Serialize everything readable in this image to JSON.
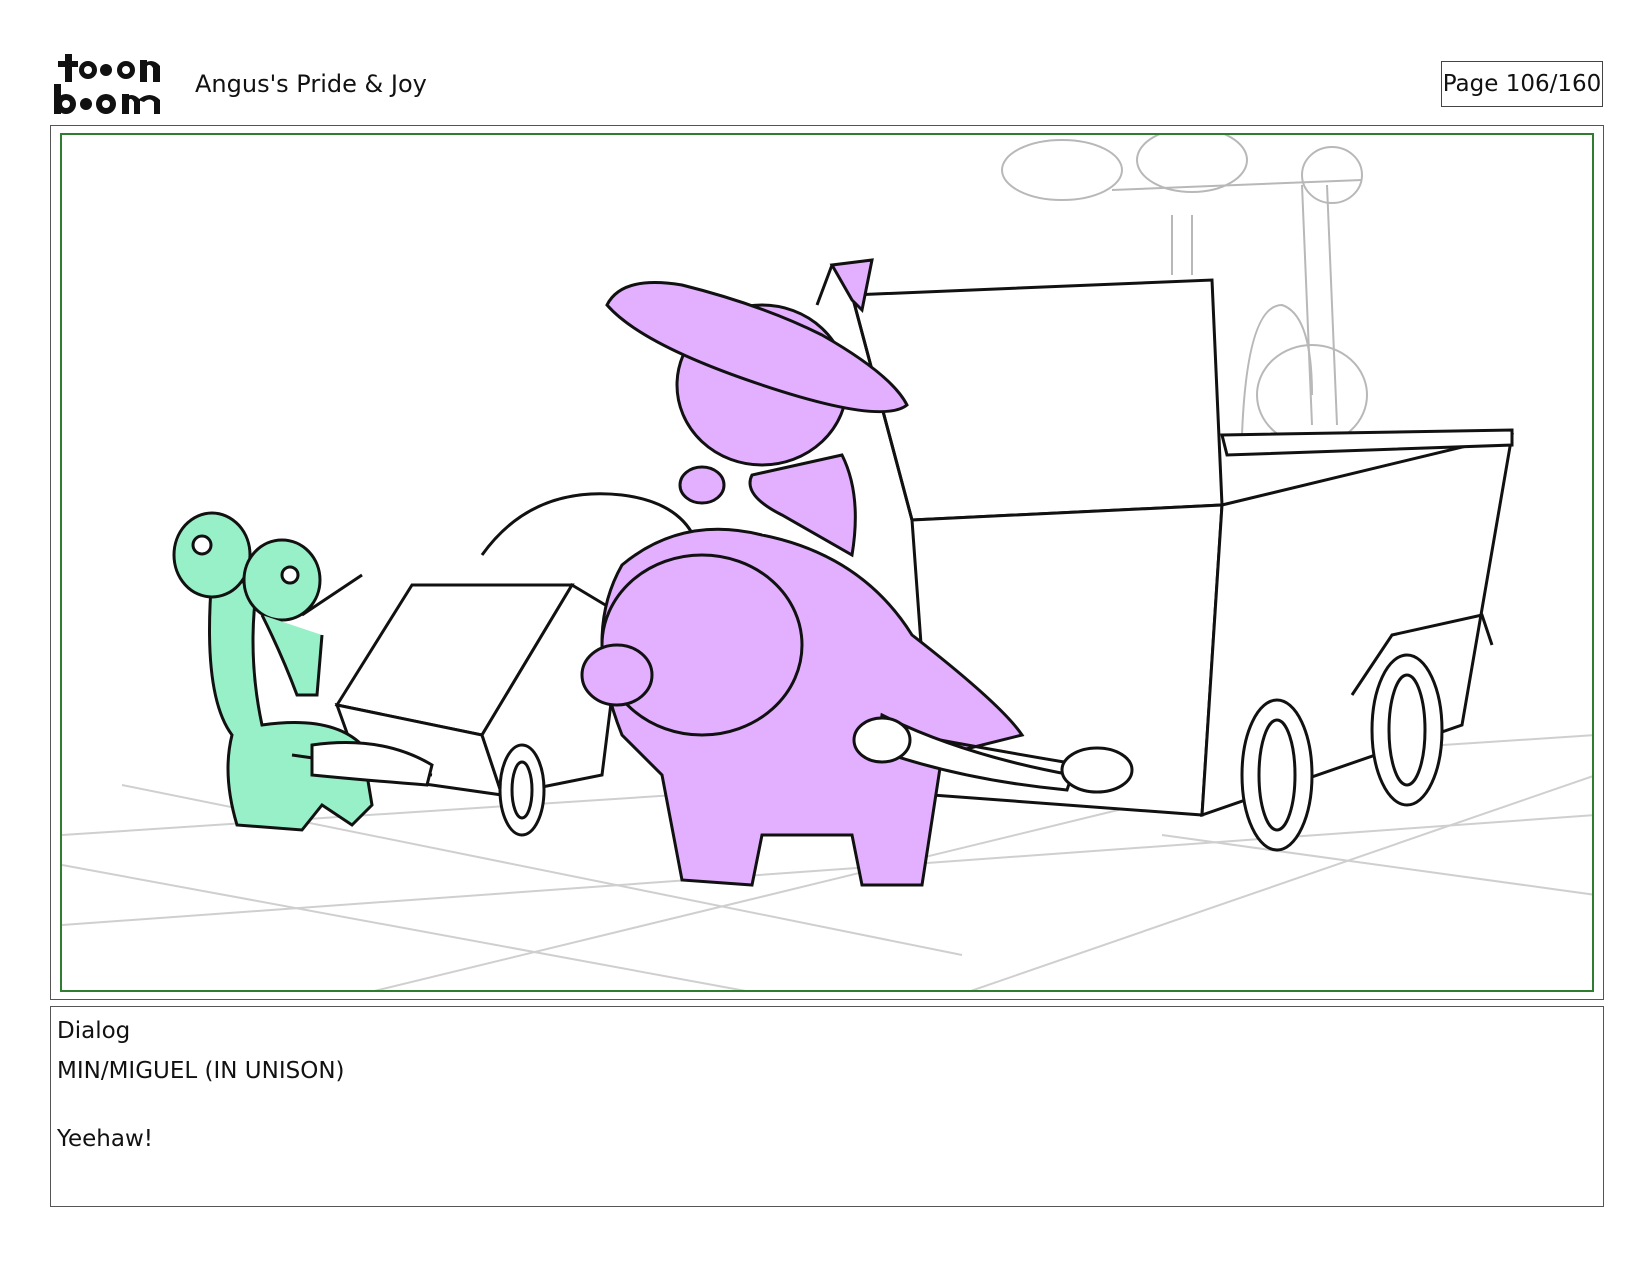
{
  "header": {
    "logo_text": "toon boom",
    "project_title": "Angus's Pride & Joy",
    "page_label": "Page 106/160"
  },
  "panel": {
    "colors": {
      "frame": "#2f7d2f",
      "min_dino": "#97f0c8",
      "main_dino": "#e2b0ff",
      "sketch_line": "#111111",
      "grid_line": "#cccccc"
    }
  },
  "dialog": {
    "heading": "Dialog",
    "speaker": "MIN/MIGUEL (IN UNISON)",
    "line": "Yeehaw!"
  }
}
